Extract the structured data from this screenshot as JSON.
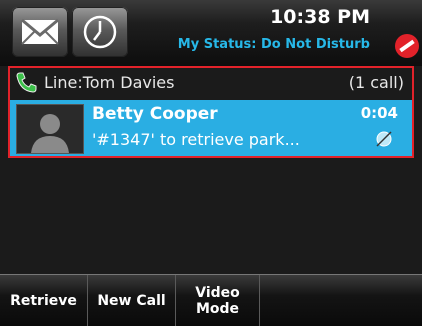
{
  "status": {
    "time": "10:38 PM",
    "my_status": "My Status: Do Not Disturb"
  },
  "line": {
    "label": "Line:Tom Davies",
    "call_count": "(1 call)"
  },
  "call": {
    "caller": "Betty Cooper",
    "duration": "0:04",
    "message": "'#1347' to retrieve park..."
  },
  "softkeys": {
    "retrieve": "Retrieve",
    "new_call": "New Call",
    "video_mode": "Video Mode"
  },
  "colors": {
    "accent": "#2aaee3",
    "highlight_border": "#e2222a",
    "status_text": "#27b8e8"
  },
  "icons": {
    "messages": "envelope-icon",
    "recent": "clock-icon",
    "dnd": "do-not-disturb-icon",
    "line": "phone-handset-icon",
    "video": "video-off-icon"
  }
}
